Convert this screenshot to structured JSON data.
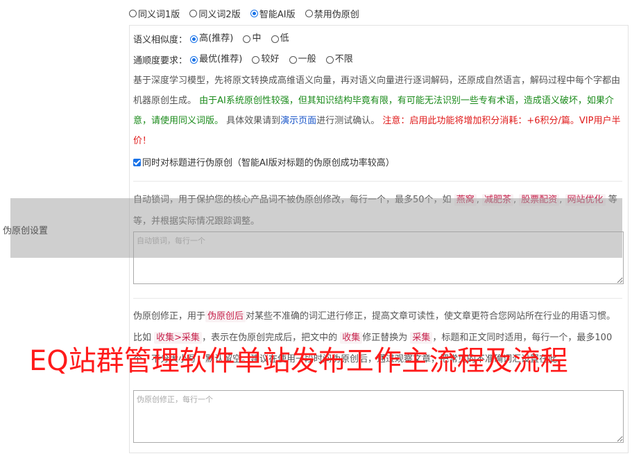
{
  "version_options": [
    {
      "label": "同义词1版",
      "checked": false
    },
    {
      "label": "同义词2版",
      "checked": false
    },
    {
      "label": "智能AI版",
      "checked": true
    },
    {
      "label": "禁用伪原创",
      "checked": false
    }
  ],
  "similarity": {
    "label": "语义相似度：",
    "options": [
      {
        "label": "高(推荐)",
        "checked": true
      },
      {
        "label": "中",
        "checked": false
      },
      {
        "label": "低",
        "checked": false
      }
    ]
  },
  "fluency": {
    "label": "通顺度要求：",
    "options": [
      {
        "label": "最优(推荐)",
        "checked": true
      },
      {
        "label": "较好",
        "checked": false
      },
      {
        "label": "一般",
        "checked": false
      },
      {
        "label": "不限",
        "checked": false
      }
    ]
  },
  "description": {
    "intro": "基于深度学习模型，先将原文转换成高维语义向量，再对语义向量进行逐词解码，还原成自然语言，解码过程中每个字都由机器原创生成。",
    "warning_green": "由于AI系统原创性较强，但其知识结构毕竟有限，有可能无法识别一些专有术语，造成语义破坏，如果介意，请使用同义词版。",
    "test_prefix": "具体效果请到",
    "demo_link": "演示页面",
    "test_suffix": "进行测试确认。",
    "note_red": "注意：启用此功能将增加积分消耗：+6积分/篇。VIP用户半价！"
  },
  "title_checkbox": {
    "label": "同时对标题进行伪原创（智能AI版对标题的伪原创成功率较高）",
    "checked": true
  },
  "lock_words": {
    "text_prefix": "自动锁词，用于保护您的核心产品词不被伪原创修改，每行一个，最多50个，如",
    "examples": [
      "燕窝",
      "减肥茶",
      "股票配资",
      "网站优化"
    ],
    "text_suffix": "等等，并根据实际情况跟踪调整。",
    "placeholder": "自动锁词，每行一个"
  },
  "correction": {
    "text_prefix": "伪原创修正，用于",
    "tag_main": "伪原创后",
    "text_mid1": "对某些不准确的词汇进行修正，提高文章可读性，使文章更符合您网站所在行业的用语习惯。比如",
    "tag_pair": "收集>采集",
    "text_mid2": "，表示在伪原创完成后，把文中的",
    "tag_from": "收集",
    "text_mid3": "修正替换为",
    "tag_to": "采集",
    "text_tail": "，标题和正文同时适用，每行一个，最多100个，不分大小写，默认留空。建议在使用一段时间伪原创后，通过观察文章，把常见的不准确词汇设置在此。",
    "placeholder": "伪原创修正，每行一个"
  },
  "side_label": "伪原创设置",
  "watermark": "EQ站群管理软件单站发布工作主流程及流程"
}
